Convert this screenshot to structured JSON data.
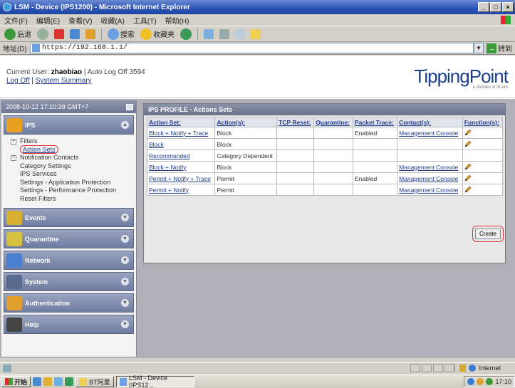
{
  "window": {
    "title": "LSM - Device (IPS1200) - Microsoft Internet Explorer",
    "controls": [
      "_",
      "□",
      "×"
    ]
  },
  "menubar": [
    "文件(F)",
    "编辑(E)",
    "查看(V)",
    "收藏(A)",
    "工具(T)",
    "帮助(H)"
  ],
  "toolbar": {
    "back_label": "后退",
    "search_label": "搜索",
    "favorites_label": "收藏夹"
  },
  "address": {
    "label": "地址(D)",
    "url": "https://192.168.1.1/",
    "go_label": "转到"
  },
  "header": {
    "current_user_prefix": "Current User: ",
    "current_user": "zhaobiao",
    "auto_logoff": " | Auto Log Off 3594",
    "logoff_link": "Log Off",
    "separator": " | ",
    "summary_link": "System Summary",
    "logo": "TippingPoint",
    "logo_sub": "a division of 3Com"
  },
  "leftnav": {
    "datetime": "2008-10-12 17:10:39 GMT+7",
    "sections": [
      {
        "label": "IPS",
        "color": "#e8a020"
      },
      {
        "label": "Events",
        "color": "#d8b030"
      },
      {
        "label": "Quarantine",
        "color": "#d8c040"
      },
      {
        "label": "Network",
        "color": "#4a7fd0"
      },
      {
        "label": "System",
        "color": "#5a6a90"
      },
      {
        "label": "Authentication",
        "color": "#e0a030"
      },
      {
        "label": "Help",
        "color": "#444"
      }
    ],
    "ips_items": [
      {
        "label": "Filters",
        "type": "expand",
        "sign": "+"
      },
      {
        "label": "Action Sets",
        "type": "active"
      },
      {
        "label": "Notification Contacts",
        "type": "expand",
        "sign": "+"
      },
      {
        "label": "Category Settings",
        "type": "sub"
      },
      {
        "label": "IPS Services",
        "type": "sub"
      },
      {
        "label": "Settings - Application Protection",
        "type": "sub"
      },
      {
        "label": "Settings - Performance Protection",
        "type": "sub"
      },
      {
        "label": "Reset Filters",
        "type": "sub"
      }
    ]
  },
  "panel": {
    "title": "IPS PROFILE - Actions Sets",
    "columns": [
      "Action Set:",
      "Action(s):",
      "TCP Reset:",
      "Quarantine:",
      "Packet Trace:",
      "Contact(s):",
      "Function(s):"
    ],
    "rows": [
      {
        "name": "Block + Notify + Trace",
        "actions": "Block",
        "tcp": "",
        "quarantine": "",
        "trace": "Enabled",
        "contact": "Management Console",
        "edit": true
      },
      {
        "name": "Block",
        "actions": "Block",
        "tcp": "",
        "quarantine": "",
        "trace": "",
        "contact": "",
        "edit": true
      },
      {
        "name": "Recommended",
        "actions": "Category Dependent",
        "tcp": "",
        "quarantine": "",
        "trace": "",
        "contact": "",
        "edit": false
      },
      {
        "name": "Block + Notify",
        "actions": "Block",
        "tcp": "",
        "quarantine": "",
        "trace": "",
        "contact": "Management Console",
        "edit": true
      },
      {
        "name": "Permit + Notify + Trace",
        "actions": "Permit",
        "tcp": "",
        "quarantine": "",
        "trace": "Enabled",
        "contact": "Management Console",
        "edit": true
      },
      {
        "name": "Permit + Notify",
        "actions": "Permit",
        "tcp": "",
        "quarantine": "",
        "trace": "",
        "contact": "Management Console",
        "edit": true
      }
    ],
    "create_label": "Create"
  },
  "statusbar": {
    "zone": "Internet"
  },
  "taskbar": {
    "start": "开始",
    "folder_item": "BT阿里",
    "active_window": "LSM - Device (IPS12...",
    "clock": "17:10"
  }
}
